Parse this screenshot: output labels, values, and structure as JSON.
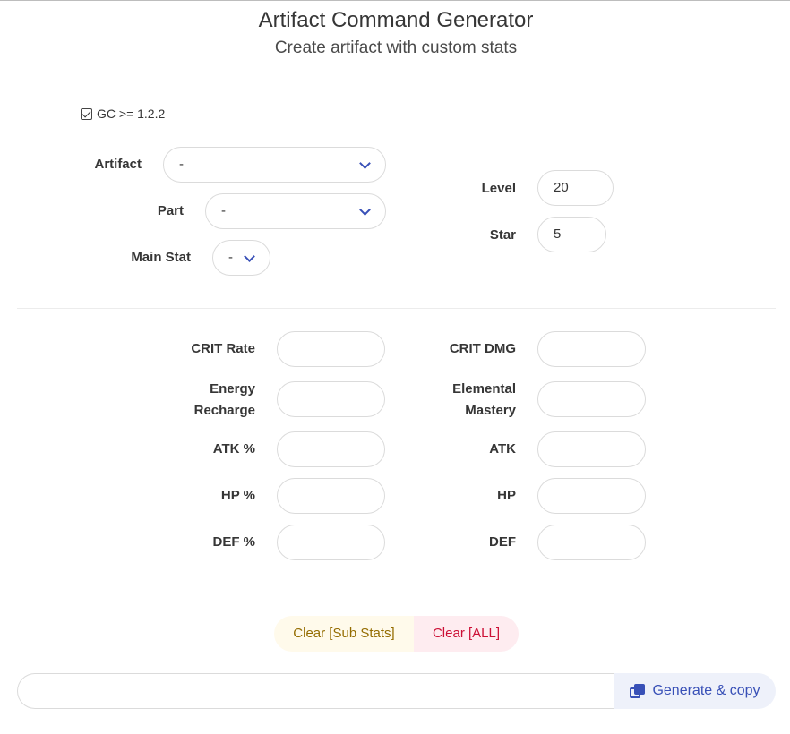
{
  "header": {
    "title": "Artifact Command Generator",
    "subtitle": "Create artifact with custom stats"
  },
  "options": {
    "gc_label": "GC >= 1.2.2",
    "gc_checked": true
  },
  "artifact": {
    "artifact_label": "Artifact",
    "artifact_value": "-",
    "part_label": "Part",
    "part_value": "-",
    "main_stat_label": "Main Stat",
    "main_stat_value": "-",
    "level_label": "Level",
    "level_value": "20",
    "star_label": "Star",
    "star_value": "5"
  },
  "substats": {
    "crit_rate": "CRIT Rate",
    "crit_dmg": "CRIT DMG",
    "energy_recharge_1": "Energy",
    "energy_recharge_2": "Recharge",
    "elemental_mastery_1": "Elemental",
    "elemental_mastery_2": "Mastery",
    "atk_pct": "ATK %",
    "atk": "ATK",
    "hp_pct": "HP %",
    "hp": "HP",
    "def_pct": "DEF %",
    "def": "DEF"
  },
  "actions": {
    "clear_sub_stats": "Clear [Sub Stats]",
    "clear_all": "Clear [ALL]",
    "generate_copy": "Generate & copy",
    "command_value": ""
  },
  "colors": {
    "accent": "#3850b7",
    "warning_bg": "#fffaeb",
    "warning_text": "#946c00",
    "danger_bg": "#feecf0",
    "danger_text": "#cc0f35"
  },
  "icons": {
    "dropdown": "chevron-down-icon",
    "copy": "copy-icon",
    "checkbox": "checkbox-checked-icon"
  }
}
